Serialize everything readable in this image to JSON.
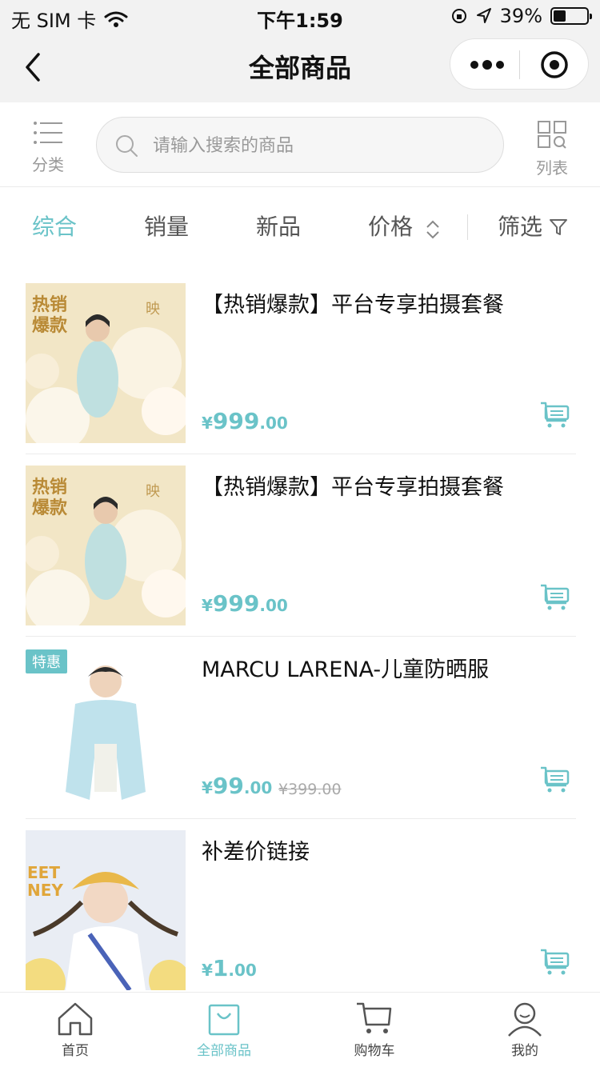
{
  "status_bar": {
    "carrier": "无 SIM 卡",
    "time": "下午1:59",
    "battery": "39%",
    "battery_level": 0.39
  },
  "nav": {
    "title": "全部商品"
  },
  "search": {
    "category_label": "分类",
    "placeholder": "请输入搜索的商品",
    "list_label": "列表"
  },
  "sort_tabs": {
    "comprehensive": "综合",
    "sales": "销量",
    "new": "新品",
    "price": "价格",
    "filter": "筛选"
  },
  "products": [
    {
      "title": "【热销爆款】平台专享拍摄套餐",
      "price_yen": "¥",
      "price_int": "999",
      "price_dec": ".00",
      "old_price": "",
      "badge": "",
      "image_caption": "热销爆款"
    },
    {
      "title": "【热销爆款】平台专享拍摄套餐",
      "price_yen": "¥",
      "price_int": "999",
      "price_dec": ".00",
      "old_price": "",
      "badge": "",
      "image_caption": "热销爆款"
    },
    {
      "title": "MARCU LARENA-儿童防晒服",
      "price_yen": "¥",
      "price_int": "99",
      "price_dec": ".00",
      "old_price": "¥399.00",
      "badge": "特惠",
      "image_caption": ""
    },
    {
      "title": "补差价链接",
      "price_yen": "¥",
      "price_int": "1",
      "price_dec": ".00",
      "old_price": "",
      "badge": "",
      "image_caption": ""
    }
  ],
  "tab_bar": {
    "home": "首页",
    "all_products": "全部商品",
    "cart": "购物车",
    "mine": "我的"
  },
  "colors": {
    "accent": "#6ac3c8",
    "navbar_bg": "#f2f2f2",
    "price": "#6ac3c8",
    "text": "#222222"
  }
}
